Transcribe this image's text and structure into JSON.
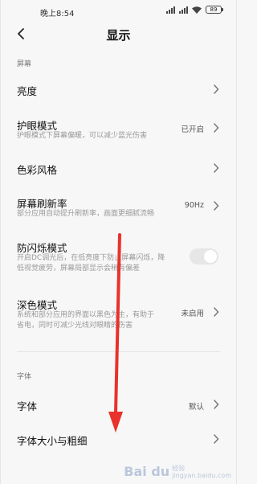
{
  "status_bar": {
    "time": "晚上8:54",
    "battery": "89"
  },
  "header": {
    "title": "显示"
  },
  "sections": {
    "screen": "屏幕",
    "font": "字体"
  },
  "rows": {
    "brightness": {
      "label": "亮度"
    },
    "eye_care": {
      "label": "护眼模式",
      "desc": "护眼模式下屏幕偏暖，可以减少蓝光伤害",
      "value": "已开启"
    },
    "color_style": {
      "label": "色彩风格"
    },
    "refresh_rate": {
      "label": "屏幕刷新率",
      "desc": "部分应用自动提升刷新率，画面更细腻流畅",
      "value": "90Hz"
    },
    "anti_flicker": {
      "label": "防闪烁模式",
      "desc1": "开启DC调光后，在低亮度下防止屏幕闪烁，降",
      "desc2": "低视觉疲劳，屏幕局部显示会稍有偏差",
      "enabled": false
    },
    "dark_mode": {
      "label": "深色模式",
      "desc1": "系统和部分应用的界面以黑色为主，有助于",
      "desc2": "省电，同时可减少光线对眼睛的伤害",
      "value": "未启用"
    },
    "font": {
      "label": "字体",
      "value": "默认"
    },
    "font_size": {
      "label": "字体大小与粗细"
    }
  },
  "watermark": {
    "logo": "Bai du",
    "text": "经验",
    "sub": "jingyan.baidu.com"
  },
  "annotation": {
    "color": "#e8322b"
  }
}
